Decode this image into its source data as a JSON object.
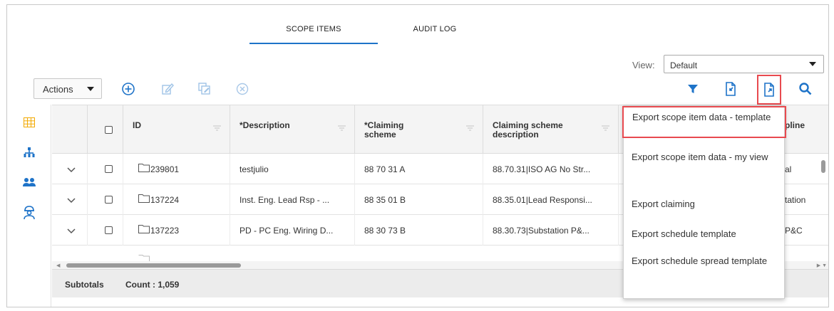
{
  "tabs": [
    {
      "label": "SCOPE ITEMS",
      "active": true
    },
    {
      "label": "AUDIT LOG",
      "active": false
    }
  ],
  "view": {
    "label": "View:",
    "selected": "Default"
  },
  "toolbar": {
    "actions_label": "Actions",
    "left_icons": [
      "add-icon",
      "edit-icon",
      "bulk-edit-icon",
      "cancel-icon"
    ],
    "right_icons": [
      "filter-icon",
      "import-icon",
      "export-icon",
      "search-icon"
    ]
  },
  "left_rail": [
    "grid-view-icon",
    "hierarchy-icon",
    "users-icon",
    "engineer-icon"
  ],
  "grid": {
    "columns": [
      {
        "label": ""
      },
      {
        "label": ""
      },
      {
        "label": "ID"
      },
      {
        "label": "*Description"
      },
      {
        "label": "*Claiming scheme"
      },
      {
        "label": "Claiming scheme description"
      },
      {
        "label": "pline"
      }
    ],
    "rows": [
      {
        "id": "239801",
        "description": "testjulio",
        "claiming_scheme": "88 70 31 A",
        "scheme_description": "88.70.31|ISO AG No Str...",
        "discipline": "al"
      },
      {
        "id": "137224",
        "description": "Inst. Eng. Lead Rsp - ...",
        "claiming_scheme": "88 35 01 B",
        "scheme_description": "88.35.01|Lead Responsi...",
        "discipline": "tation"
      },
      {
        "id": "137223",
        "description": "PD - PC Eng. Wiring D...",
        "claiming_scheme": "88 30 73 B",
        "scheme_description": "88.30.73|Substation P&...",
        "discipline": "P&C"
      }
    ],
    "subtotals_label": "Subtotals",
    "count_label": "Count : 1,059"
  },
  "export_menu": {
    "items": [
      {
        "label": "Export scope item data - template",
        "highlighted": true
      },
      {
        "label": "Export scope item data - my view",
        "highlighted": false
      },
      {
        "label": "Export claiming",
        "highlighted": false
      },
      {
        "label": "Export schedule template",
        "highlighted": false
      },
      {
        "label": "Export schedule spread template",
        "highlighted": false
      }
    ]
  },
  "colors": {
    "accent": "#1e73c8",
    "highlight": "#e84a4f",
    "rail_orange": "#f2a900",
    "rail_blue": "#1e73c8"
  }
}
